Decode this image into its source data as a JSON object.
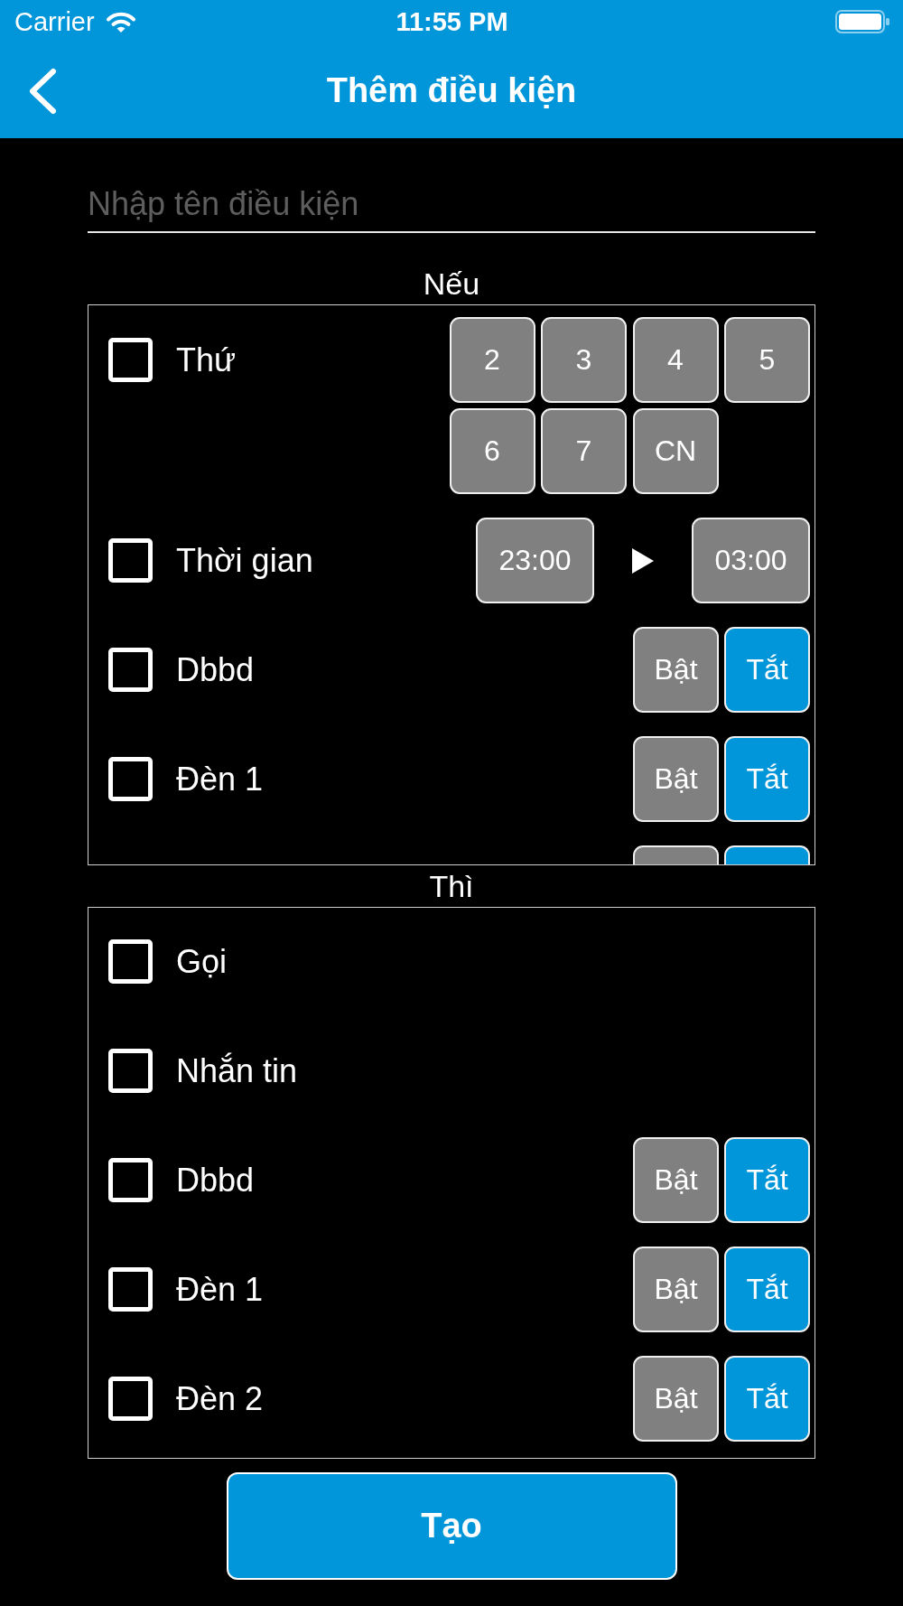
{
  "status_bar": {
    "carrier": "Carrier",
    "time": "11:55 PM"
  },
  "nav_bar": {
    "title": "Thêm điều kiện"
  },
  "name_field": {
    "placeholder": "Nhập tên điều kiện"
  },
  "sections": [
    {
      "title": "Nếu",
      "rows": [
        {
          "kind": "days",
          "label": "Thứ",
          "checked": false,
          "days": [
            {
              "label": "2",
              "selected": false
            },
            {
              "label": "3",
              "selected": false
            },
            {
              "label": "4",
              "selected": false
            },
            {
              "label": "5",
              "selected": false
            },
            {
              "label": "6",
              "selected": false
            },
            {
              "label": "7",
              "selected": false
            },
            {
              "label": "CN",
              "selected": false
            }
          ]
        },
        {
          "kind": "time_range",
          "label": "Thời gian",
          "checked": false,
          "start": "23:00",
          "end": "03:00"
        },
        {
          "kind": "toggle",
          "label": "Dbbd",
          "checked": false,
          "options": [
            {
              "label": "Bật",
              "selected": false
            },
            {
              "label": "Tắt",
              "selected": true
            }
          ]
        },
        {
          "kind": "toggle",
          "label": "Đèn 1",
          "checked": false,
          "options": [
            {
              "label": "Bật",
              "selected": false
            },
            {
              "label": "Tắt",
              "selected": true
            }
          ]
        },
        {
          "kind": "cut_off",
          "options": [
            {
              "selected": false
            },
            {
              "selected": true
            }
          ]
        }
      ]
    },
    {
      "title": "Thì",
      "rows": [
        {
          "kind": "plain",
          "label": "Gọi",
          "checked": false
        },
        {
          "kind": "plain",
          "label": "Nhắn tin",
          "checked": false
        },
        {
          "kind": "toggle",
          "label": "Dbbd",
          "checked": false,
          "options": [
            {
              "label": "Bật",
              "selected": false
            },
            {
              "label": "Tắt",
              "selected": true
            }
          ]
        },
        {
          "kind": "toggle",
          "label": "Đèn 1",
          "checked": false,
          "options": [
            {
              "label": "Bật",
              "selected": false
            },
            {
              "label": "Tắt",
              "selected": true
            }
          ]
        },
        {
          "kind": "toggle",
          "label": "Đèn 2",
          "checked": false,
          "options": [
            {
              "label": "Bật",
              "selected": false
            },
            {
              "label": "Tắt",
              "selected": true
            }
          ]
        }
      ]
    }
  ],
  "create_button": {
    "label": "Tạo"
  }
}
